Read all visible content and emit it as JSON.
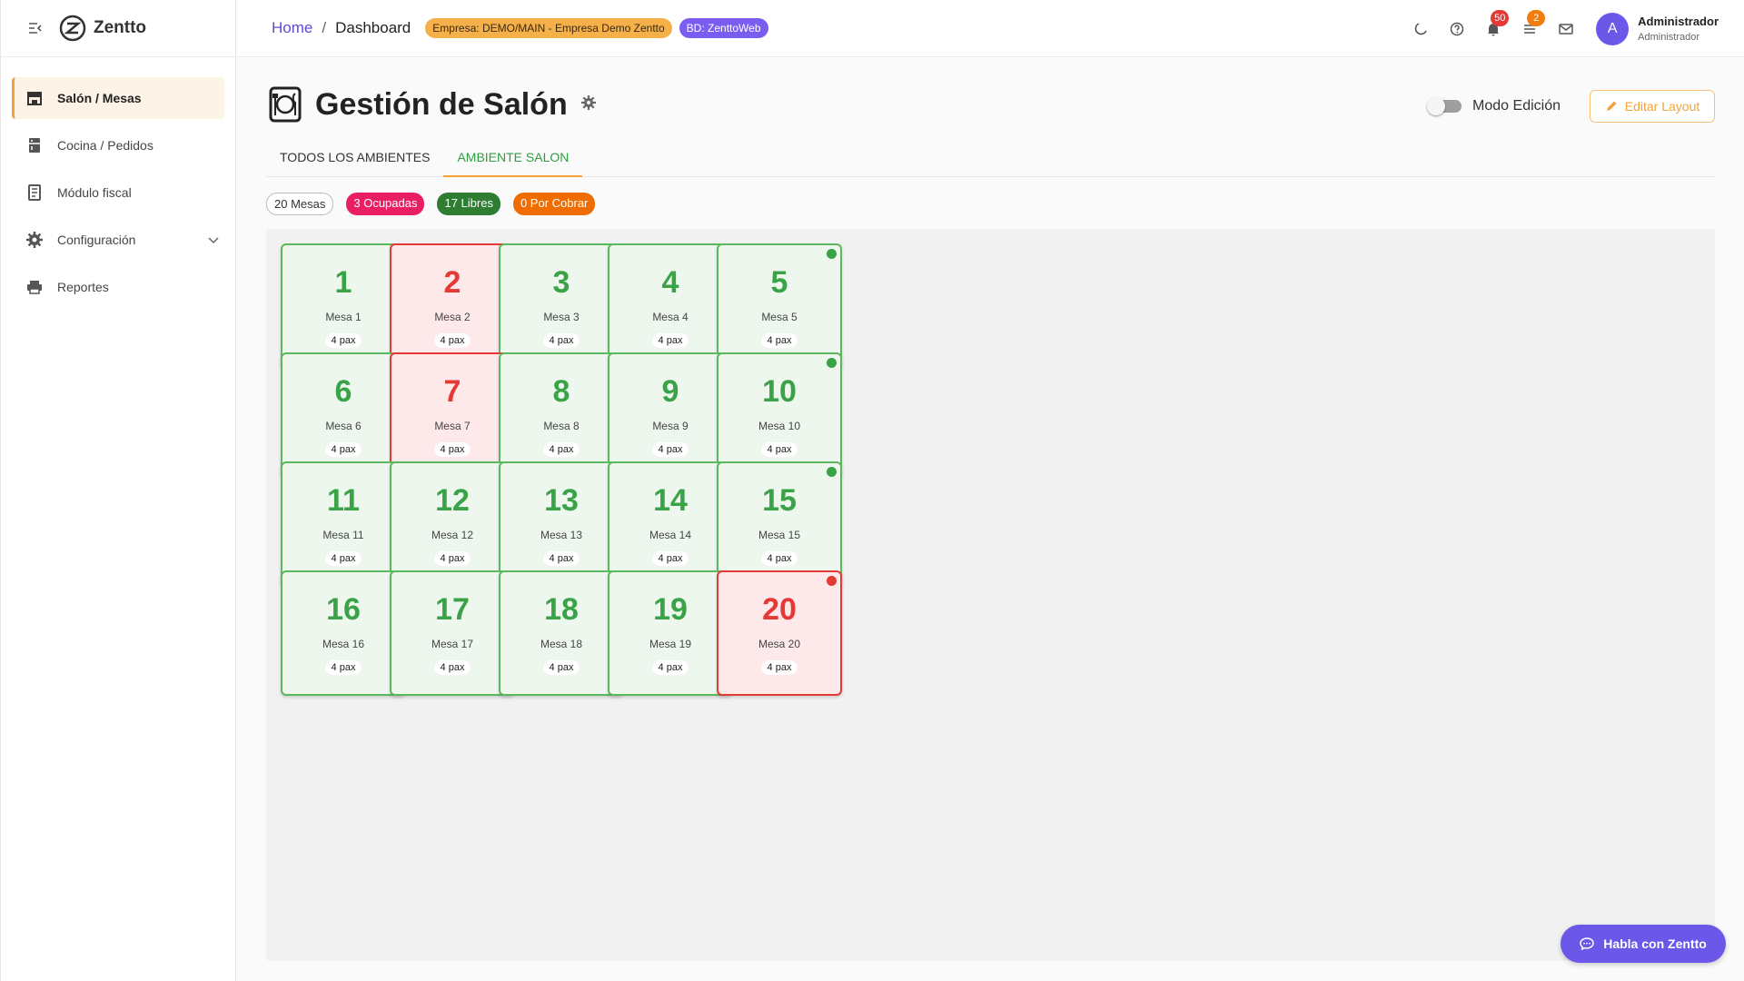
{
  "app": {
    "name": "Zentto"
  },
  "sidebar": {
    "items": [
      {
        "label": "Salón / Mesas",
        "icon": "storefront-icon",
        "active": true
      },
      {
        "label": "Cocina / Pedidos",
        "icon": "kitchen-icon",
        "active": false
      },
      {
        "label": "Módulo fiscal",
        "icon": "receipt-icon",
        "active": false
      },
      {
        "label": "Configuración",
        "icon": "gear-icon",
        "active": false
      },
      {
        "label": "Reportes",
        "icon": "printer-icon",
        "active": false
      }
    ]
  },
  "topbar": {
    "breadcrumb": {
      "home": "Home",
      "separator": "/",
      "current": "Dashboard"
    },
    "chips": {
      "empresa": "Empresa: DEMO/MAIN - Empresa Demo Zentto",
      "bd": "BD: ZenttoWeb"
    },
    "notifications_count": "50",
    "tasks_count": "2",
    "user": {
      "initial": "A",
      "name": "Administrador",
      "role": "Administrador"
    }
  },
  "page": {
    "title": "Gestión de Salón",
    "mode_label": "Modo Edición",
    "edit_layout_label": "Editar Layout",
    "tabs": [
      {
        "label": "Todos los ambientes",
        "active": false
      },
      {
        "label": "Ambiente Salon",
        "active": true
      }
    ],
    "stats": {
      "total": "20 Mesas",
      "busy": "3 Ocupadas",
      "free": "17 Libres",
      "due": "0 Por Cobrar"
    }
  },
  "tables": [
    {
      "num": "1",
      "name": "Mesa 1",
      "pax": "4 pax",
      "status": "free",
      "dot": false
    },
    {
      "num": "2",
      "name": "Mesa 2",
      "pax": "4 pax",
      "status": "busy",
      "dot": false
    },
    {
      "num": "3",
      "name": "Mesa 3",
      "pax": "4 pax",
      "status": "free",
      "dot": false
    },
    {
      "num": "4",
      "name": "Mesa 4",
      "pax": "4 pax",
      "status": "free",
      "dot": false
    },
    {
      "num": "5",
      "name": "Mesa 5",
      "pax": "4 pax",
      "status": "free",
      "dot": true
    },
    {
      "num": "6",
      "name": "Mesa 6",
      "pax": "4 pax",
      "status": "free",
      "dot": false
    },
    {
      "num": "7",
      "name": "Mesa 7",
      "pax": "4 pax",
      "status": "busy",
      "dot": false
    },
    {
      "num": "8",
      "name": "Mesa 8",
      "pax": "4 pax",
      "status": "free",
      "dot": false
    },
    {
      "num": "9",
      "name": "Mesa 9",
      "pax": "4 pax",
      "status": "free",
      "dot": false
    },
    {
      "num": "10",
      "name": "Mesa 10",
      "pax": "4 pax",
      "status": "free",
      "dot": true
    },
    {
      "num": "11",
      "name": "Mesa 11",
      "pax": "4 pax",
      "status": "free",
      "dot": false
    },
    {
      "num": "12",
      "name": "Mesa 12",
      "pax": "4 pax",
      "status": "free",
      "dot": false
    },
    {
      "num": "13",
      "name": "Mesa 13",
      "pax": "4 pax",
      "status": "free",
      "dot": false
    },
    {
      "num": "14",
      "name": "Mesa 14",
      "pax": "4 pax",
      "status": "free",
      "dot": false
    },
    {
      "num": "15",
      "name": "Mesa 15",
      "pax": "4 pax",
      "status": "free",
      "dot": true
    },
    {
      "num": "16",
      "name": "Mesa 16",
      "pax": "4 pax",
      "status": "free",
      "dot": false
    },
    {
      "num": "17",
      "name": "Mesa 17",
      "pax": "4 pax",
      "status": "free",
      "dot": false
    },
    {
      "num": "18",
      "name": "Mesa 18",
      "pax": "4 pax",
      "status": "free",
      "dot": false
    },
    {
      "num": "19",
      "name": "Mesa 19",
      "pax": "4 pax",
      "status": "free",
      "dot": false
    },
    {
      "num": "20",
      "name": "Mesa 20",
      "pax": "4 pax",
      "status": "busy",
      "dot": true
    }
  ],
  "chat": {
    "label": "Habla con Zentto"
  },
  "colors": {
    "accent": "#6b57e8",
    "free": "#3aa347",
    "busy": "#e53935",
    "highlight": "#f2a33a"
  }
}
